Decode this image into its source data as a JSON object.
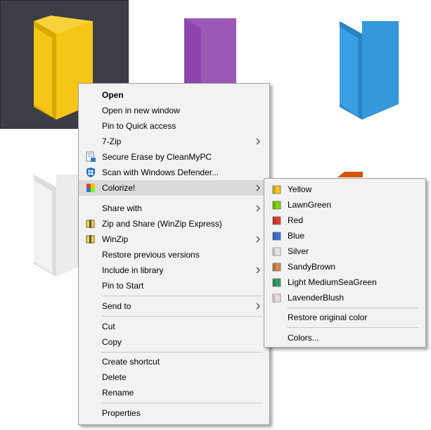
{
  "colors": {
    "yellow_folder": "#f5c518",
    "purple_folder": "#9b59b6",
    "blue_folder": "#3498db",
    "silver_folder": "#ececec",
    "orange_folder": "#d35400",
    "selection_bg": "#3c3d45"
  },
  "main_menu": {
    "open": "Open",
    "open_new_window": "Open in new window",
    "pin_quick_access": "Pin to Quick access",
    "seven_zip": "7-Zip",
    "secure_erase": "Secure Erase by CleanMyPC",
    "scan_defender": "Scan with Windows Defender...",
    "colorize": "Colorize!",
    "share_with": "Share with",
    "zip_share": "Zip and Share (WinZip Express)",
    "winzip": "WinZip",
    "restore_versions": "Restore previous versions",
    "include_library": "Include in library",
    "pin_start": "Pin to Start",
    "send_to": "Send to",
    "cut": "Cut",
    "copy": "Copy",
    "create_shortcut": "Create shortcut",
    "delete": "Delete",
    "rename": "Rename",
    "properties": "Properties"
  },
  "colorize_menu": {
    "items": [
      {
        "label": "Yellow",
        "color": "#f5c518"
      },
      {
        "label": "LawnGreen",
        "color": "#7cfc00"
      },
      {
        "label": "Red",
        "color": "#e03c31"
      },
      {
        "label": "Blue",
        "color": "#3b6fd6"
      },
      {
        "label": "Silver",
        "color": "#d8d8d8"
      },
      {
        "label": "SandyBrown",
        "color": "#d9884a"
      },
      {
        "label": "Light MediumSeaGreen",
        "color": "#2e9e6b"
      },
      {
        "label": "LavenderBlush",
        "color": "#f0d8e6"
      }
    ],
    "restore": "Restore original color",
    "colors": "Colors..."
  }
}
